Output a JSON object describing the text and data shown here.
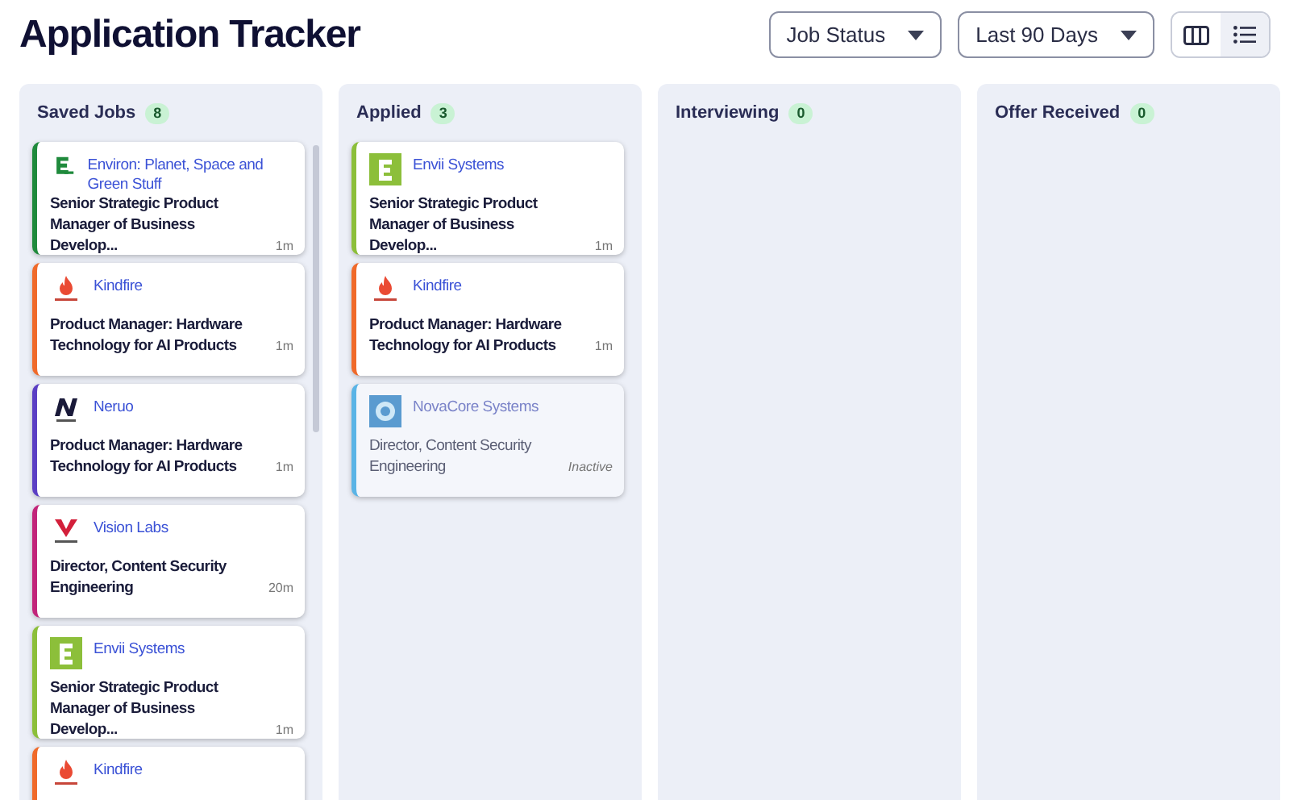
{
  "title": "Application Tracker",
  "filters": [
    {
      "label": "Job Status"
    },
    {
      "label": "Last 90 Days"
    }
  ],
  "view_toggle": [
    {
      "kind": "board",
      "selected": true
    },
    {
      "kind": "list",
      "selected": false
    }
  ],
  "columns": [
    {
      "name": "Saved Jobs",
      "count": "8",
      "cards": [
        {
          "kind": "eletter",
          "company": "Environ: Planet, Space and Green Stuff",
          "title": "Senior Strategic Product Manager of Business Develop...",
          "time": "1m",
          "color": "#1f8a3c",
          "inactive": false
        },
        {
          "kind": "flame",
          "company": "Kindfire",
          "title": "Product Manager: Hardware Technology for AI Products",
          "time": "1m",
          "color": "#f06a2a",
          "inactive": false
        },
        {
          "kind": "nmark",
          "company": "Neruo",
          "title": "Product Manager: Hardware Technology for AI Products",
          "time": "1m",
          "color": "#5b3fc4",
          "inactive": false
        },
        {
          "kind": "vmark",
          "company": "Vision Labs",
          "title": "Director, Content Security Engineering",
          "time": "20m",
          "color": "#c2257a",
          "inactive": false
        },
        {
          "kind": "eblock",
          "company": "Envii Systems",
          "title": "Senior Strategic Product Manager of Business Develop...",
          "time": "1m",
          "color": "#8cbf3a",
          "inactive": false
        },
        {
          "kind": "flame",
          "company": "Kindfire",
          "color": "#f06a2a",
          "inactive": false
        }
      ]
    },
    {
      "name": "Applied",
      "count": "3",
      "cards": [
        {
          "kind": "eblock",
          "company": "Envii Systems",
          "title": "Senior Strategic Product Manager of Business Develop...",
          "time": "1m",
          "color": "#8cbf3a",
          "inactive": false
        },
        {
          "kind": "flame",
          "company": "Kindfire",
          "title": "Product Manager: Hardware Technology for AI Products",
          "time": "1m",
          "color": "#f06a2a",
          "inactive": false
        },
        {
          "kind": "globe",
          "company": "NovaCore Systems",
          "title": "Director, Content Security Engineering",
          "time": "Inactive",
          "color": "#5ab4e6",
          "inactive": true
        }
      ]
    },
    {
      "name": "Interviewing",
      "count": "0"
    },
    {
      "name": "Offer Received",
      "count": "0"
    }
  ]
}
